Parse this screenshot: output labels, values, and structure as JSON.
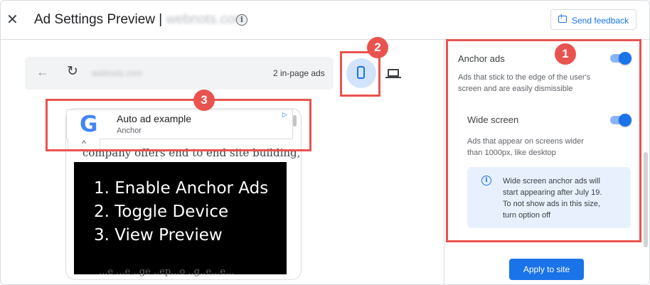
{
  "header": {
    "close_icon": "close-icon",
    "title_prefix": "Ad Settings Preview |",
    "title_site": "webnots.com",
    "info_icon": "info-icon",
    "feedback_label": "Send feedback"
  },
  "browser": {
    "back_icon": "arrow-back-icon",
    "reload_icon": "reload-icon",
    "url": "webnots.com",
    "ad_count": "2 in-page ads",
    "device_buttons": [
      "phone-icon",
      "laptop-icon"
    ]
  },
  "preview": {
    "ad_title": "Auto ad example",
    "ad_subtitle": "Anchor",
    "adchoices_icon": "adchoices-icon",
    "collapse_icon": "chevron-up-icon",
    "body_text_top": "company offers end to end site building,",
    "body_text_bottom": "...e ...e ..ge ..ep...o ..g..e...e...",
    "steps": [
      "1. Enable Anchor Ads",
      "2. Toggle Device",
      "3. View Preview"
    ]
  },
  "settings": {
    "anchor": {
      "label": "Anchor ads",
      "enabled": true,
      "desc_line1": "Ads that stick to the edge of the user's",
      "desc_line2": "screen and are easily dismissible"
    },
    "wide": {
      "label": "Wide screen",
      "enabled": true,
      "desc_line1": "Ads that appear on screens wider",
      "desc_line2": "than 1000px, like desktop"
    },
    "notice": {
      "line1": "Wide screen anchor ads will",
      "line2": "start appearing after July 19.",
      "line3": "To not show ads in this size,",
      "line4": "turn option off"
    },
    "apply_label": "Apply to site"
  },
  "annotations": {
    "badge1": "1",
    "badge2": "2",
    "badge3": "3",
    "color": "#e9534f"
  },
  "colors": {
    "accent": "#1a73e8",
    "toggle_track": "#8ab4f8",
    "notice_bg": "#e8f0fe"
  }
}
